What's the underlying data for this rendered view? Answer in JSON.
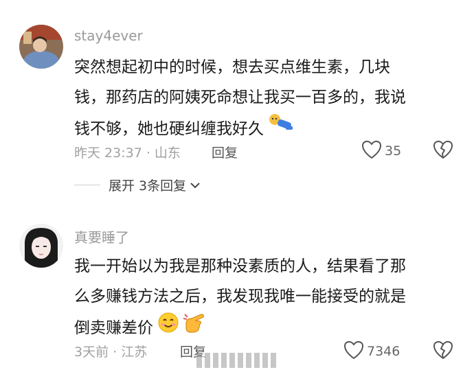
{
  "comments": [
    {
      "username": "stay4ever",
      "text_line1": "突然想起初中的时候，想去买点维生素，几块",
      "text_line2": "钱，那药店的阿姨死命想让我买一百多的，我说",
      "text_line3": "钱不够，她也硬纠缠我好久",
      "time_location": "昨天 23:37 · 山东",
      "reply_label": "回复",
      "likes": "35",
      "expand_label": "展开 3条回复"
    },
    {
      "username": "真要睡了",
      "text_line1": "我一开始以为我是那种没素质的人，结果看了那",
      "text_line2": "么多赚钱方法之后，我发现我唯一能接受的就是",
      "text_line3": "倒卖赚差价",
      "time_location": "3天前 · 江苏",
      "reply_label": "回复",
      "likes": "7346"
    }
  ],
  "icons": {
    "like": "heart-outline-icon",
    "dislike": "broken-heart-icon",
    "expand": "chevron-down-icon",
    "emoji1": "lying-figure-emoji",
    "emoji2": "smiling-face-emoji",
    "emoji3": "pointing-hand-emoji"
  },
  "colors": {
    "meta": "#a0a0a0",
    "username": "#9a9a9a",
    "text": "#1a1a1a"
  }
}
